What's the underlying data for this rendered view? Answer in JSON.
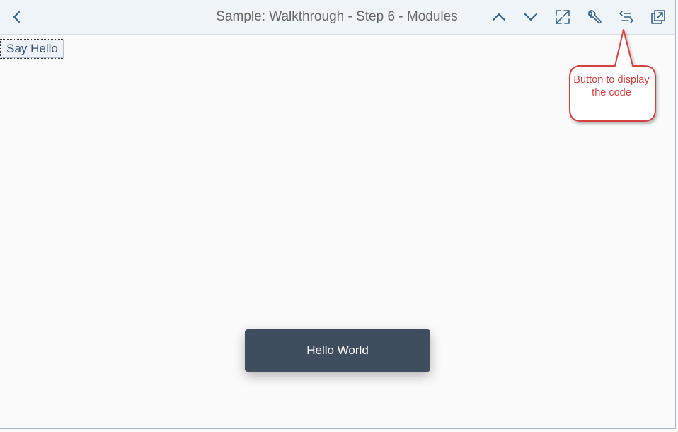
{
  "header": {
    "title": "Sample: Walkthrough - Step 6 - Modules"
  },
  "toolbar": {
    "back_icon": "chevron-left-icon",
    "prev_icon": "chevron-up-icon",
    "next_icon": "chevron-down-icon",
    "fullscreen_icon": "full-screen-icon",
    "settings_icon": "wrench-icon",
    "code_icon": "show-code-icon",
    "new_window_icon": "open-in-new-window-icon"
  },
  "main": {
    "say_hello_label": "Say Hello"
  },
  "callout": {
    "text": "Button to display the code",
    "color": "#d64242"
  },
  "toast": {
    "message": "Hello World"
  },
  "colors": {
    "header_bg": "#eff4f9",
    "icon": "#346187",
    "toast_bg": "#3f4e5e",
    "page_bg": "#fafafa"
  }
}
